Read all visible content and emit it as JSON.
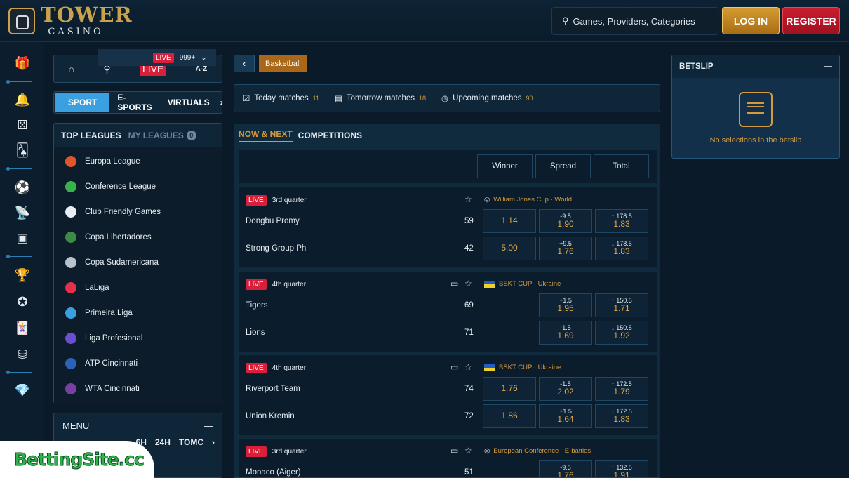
{
  "header": {
    "logo_title": "TOWER",
    "logo_sub": "-CASINO-",
    "search_placeholder": "Games, Providers, Categories",
    "login": "LOG IN",
    "register": "REGISTER"
  },
  "rail_icons": [
    "gift-icon",
    "bell-icon",
    "dice-icon",
    "cards-icon",
    "soccer-ball-icon",
    "live-signal-icon",
    "tv-icon",
    "trophy-icon",
    "award-icon",
    "poker-cards-icon",
    "chips-icon",
    "diamond-icon"
  ],
  "quicknav": {
    "live": "LIVE",
    "az": "A-Z"
  },
  "sport_tabs": [
    "SPORT",
    "E-SPORTS",
    "VIRTUALS"
  ],
  "leagues": {
    "top": "TOP LEAGUES",
    "mine": "MY LEAGUES",
    "mine_count": "0",
    "items": [
      {
        "name": "Europa League",
        "color": "#e2552b"
      },
      {
        "name": "Conference League",
        "color": "#37b24d"
      },
      {
        "name": "Club Friendly Games",
        "color": "#e6edf3"
      },
      {
        "name": "Copa Libertadores",
        "color": "#3b8a46"
      },
      {
        "name": "Copa Sudamericana",
        "color": "#b8c2cc"
      },
      {
        "name": "LaLiga",
        "color": "#e5304b"
      },
      {
        "name": "Primeira Liga",
        "color": "#3aa0e0"
      },
      {
        "name": "Liga Profesional",
        "color": "#6a4fd0"
      },
      {
        "name": "ATP Cincinnati",
        "color": "#2a63b8"
      },
      {
        "name": "WTA Cincinnati",
        "color": "#7a3fa0"
      }
    ]
  },
  "menu": {
    "title": "MENU",
    "tabs": [
      "6H",
      "24H",
      "TOMC"
    ],
    "live": "LIVE",
    "live_count": "999+"
  },
  "breadcrumb": {
    "current": "Basketball"
  },
  "dates": [
    {
      "label": "Today matches",
      "count": "11"
    },
    {
      "label": "Tomorrow matches",
      "count": "18"
    },
    {
      "label": "Upcoming matches",
      "count": "90"
    }
  ],
  "market_tabs": {
    "now": "NOW & NEXT",
    "comp": "COMPETITIONS"
  },
  "columns": [
    "Winner",
    "Spread",
    "Total"
  ],
  "matches": [
    {
      "live": "LIVE",
      "period": "3rd quarter",
      "competition": "William Jones Cup · World",
      "teams": [
        {
          "name": "Dongbu Promy",
          "score": "59",
          "winner": "1.14",
          "spread_line": "-9.5",
          "spread": "1.90",
          "total_line": "↑ 178.5",
          "total": "1.83"
        },
        {
          "name": "Strong Group Ph",
          "score": "42",
          "winner": "5.00",
          "spread_line": "+9.5",
          "spread": "1.76",
          "total_line": "↓ 178.5",
          "total": "1.83"
        }
      ]
    },
    {
      "live": "LIVE",
      "period": "4th quarter",
      "competition": "BSKT CUP · Ukraine",
      "teams": [
        {
          "name": "Tigers",
          "score": "69",
          "winner": "",
          "spread_line": "+1.5",
          "spread": "1.95",
          "total_line": "↑ 150.5",
          "total": "1.71"
        },
        {
          "name": "Lions",
          "score": "71",
          "winner": "",
          "spread_line": "-1.5",
          "spread": "1.69",
          "total_line": "↓ 150.5",
          "total": "1.92"
        }
      ]
    },
    {
      "live": "LIVE",
      "period": "4th quarter",
      "competition": "BSKT CUP · Ukraine",
      "teams": [
        {
          "name": "Riverport Team",
          "score": "74",
          "winner": "1.76",
          "spread_line": "-1.5",
          "spread": "2.02",
          "total_line": "↑ 172.5",
          "total": "1.79"
        },
        {
          "name": "Union Kremin",
          "score": "72",
          "winner": "1.86",
          "spread_line": "+1.5",
          "spread": "1.64",
          "total_line": "↓ 172.5",
          "total": "1.83"
        }
      ]
    },
    {
      "live": "LIVE",
      "period": "3rd quarter",
      "competition": "European Conference · E-battles",
      "teams": [
        {
          "name": "Monaco (Aiger)",
          "score": "51",
          "winner": "",
          "spread_line": "-9.5",
          "spread": "1.76",
          "total_line": "↑ 132.5",
          "total": "1.91"
        }
      ]
    }
  ],
  "betslip": {
    "title": "BETSLIP",
    "empty": "No selections in the betslip"
  },
  "brand": {
    "text": "BettingSite.cc"
  }
}
